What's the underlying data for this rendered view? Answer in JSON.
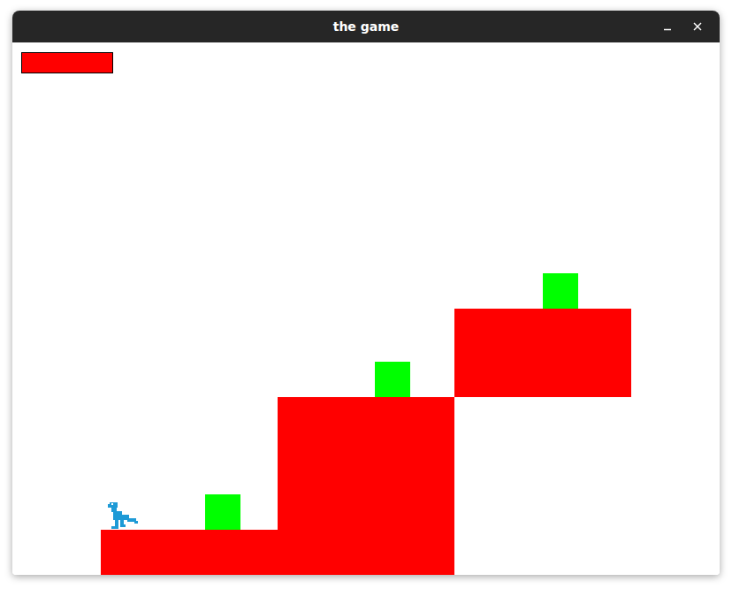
{
  "window": {
    "title": "the game"
  },
  "health": {
    "level": 1
  }
}
